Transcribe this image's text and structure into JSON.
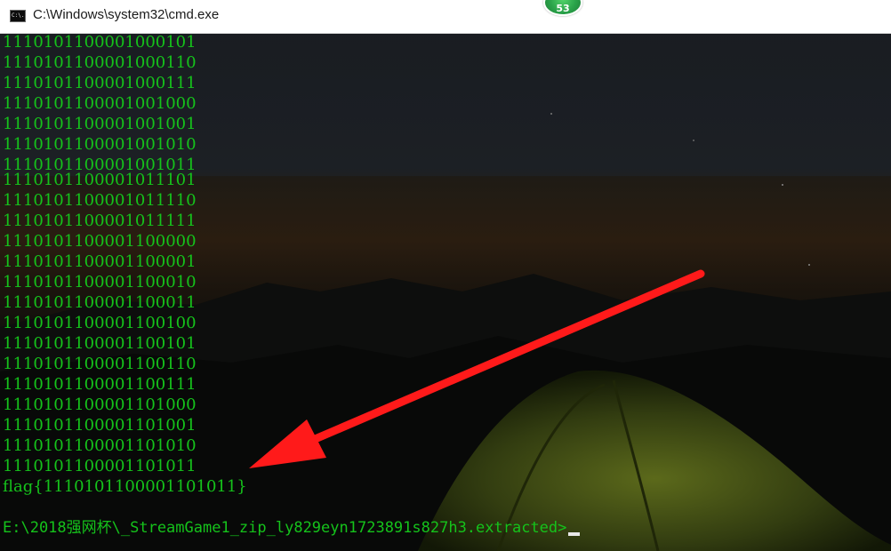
{
  "window": {
    "title": "C:\\Windows\\system32\\cmd.exe",
    "icon": "cmd-icon",
    "icon_text": "C:\\."
  },
  "badge": {
    "count": "53",
    "color": "#2aa34a"
  },
  "console": {
    "text_color": "#15c21b",
    "lines": [
      "1110101100001000101",
      "1110101100001000110",
      "1110101100001000111",
      "1110101100001001000",
      "1110101100001001001",
      "1110101100001001010",
      "1110101100001001011",
      "1110101100001011101",
      "1110101100001011110",
      "1110101100001011111",
      "1110101100001100000",
      "1110101100001100001",
      "1110101100001100010",
      "1110101100001100011",
      "1110101100001100100",
      "1110101100001100101",
      "1110101100001100110",
      "1110101100001100111",
      "1110101100001101000",
      "1110101100001101001",
      "1110101100001101010",
      "1110101100001101011",
      "flag{1110101100001101011}"
    ],
    "prompt": "E:\\2018强网杯\\_StreamGame1_zip_ly829eyn1723891s827h3.extracted>"
  },
  "annotation": {
    "arrow_color": "#ff1a1a",
    "icon": "red-arrow-icon"
  }
}
